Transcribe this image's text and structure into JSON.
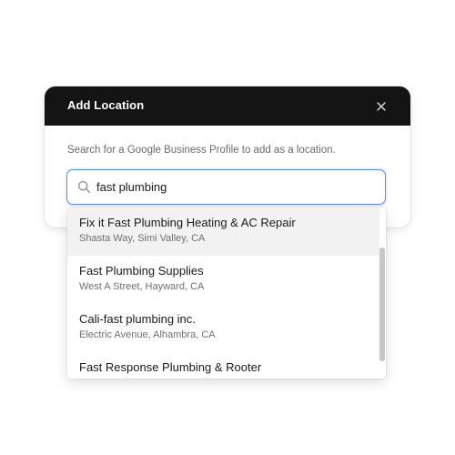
{
  "modal": {
    "title": "Add Location",
    "helper_text": "Search for a Google Business Profile to add as a location."
  },
  "search": {
    "value": "fast plumbing",
    "icon": "search-icon"
  },
  "close": {
    "icon": "close-icon"
  },
  "results": [
    {
      "name": "Fix it Fast Plumbing Heating & AC Repair",
      "address": "Shasta Way, Simi Valley, CA",
      "highlighted": true
    },
    {
      "name": "Fast Plumbing Supplies",
      "address": "West A Street, Hayward, CA",
      "highlighted": false
    },
    {
      "name": "Cali-fast plumbing inc.",
      "address": "Electric Avenue, Alhambra, CA",
      "highlighted": false
    },
    {
      "name": "Fast Response Plumbing & Rooter",
      "address": "",
      "highlighted": false
    }
  ],
  "colors": {
    "header_bg": "#141414",
    "focus_border": "#5b8def",
    "highlight_bg": "#f2f2f2"
  }
}
